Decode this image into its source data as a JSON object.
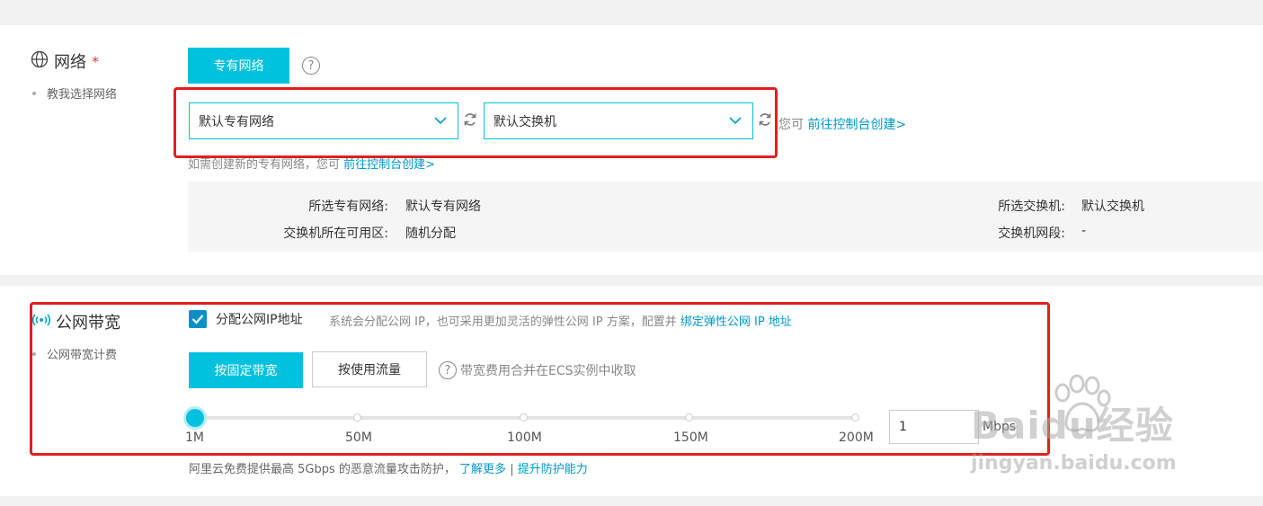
{
  "network": {
    "title": "网络",
    "required_mark": "*",
    "guide_link": "教我选择网络",
    "type_button": "专有网络",
    "help_glyph": "?",
    "vpc_select": "默认专有网络",
    "vswitch_select": "默认交换机",
    "create_prefix": "您可",
    "create_link": "前往控制台创建>",
    "hint_prefix": "如需创建新的专有网络，您可",
    "hint_link": "前往控制台创建>",
    "info": {
      "vpc_label": "所选专有网络:",
      "vpc_value": "默认专有网络",
      "zone_label": "交换机所在可用区:",
      "zone_value": "随机分配",
      "vswitch_label": "所选交换机:",
      "vswitch_value": "默认交换机",
      "cidr_label": "交换机网段:",
      "cidr_value": "-"
    }
  },
  "bandwidth": {
    "title": "公网带宽",
    "billing_link": "公网带宽计费",
    "assign_ip_checkbox": "分配公网IP地址",
    "assign_ip_checked": true,
    "assign_ip_desc": "系统会分配公网 IP，也可采用更加灵活的弹性公网 IP 方案，配置并",
    "eip_link": "绑定弹性公网 IP 地址",
    "fixed_button": "按固定带宽",
    "traffic_button": "按使用流量",
    "billing_note": "带宽费用合并在ECS实例中收取",
    "slider_value": 1,
    "slider_max": 200,
    "ticks": [
      "1M",
      "50M",
      "100M",
      "150M",
      "200M"
    ],
    "input_value": "1",
    "unit": "Mbps",
    "ddos_text": "阿里云免费提供最高 5Gbps 的恶意流量攻击防护，",
    "learn_more": "了解更多",
    "separator": "|",
    "upgrade_link": "提升防护能力"
  },
  "watermark": {
    "brand": "Baidu经验",
    "url": "jingyan.baidu.com"
  },
  "colors": {
    "primary": "#00c1de",
    "link": "#0099cc",
    "highlight_box": "#e02020",
    "checkbox": "#0a90c4"
  }
}
